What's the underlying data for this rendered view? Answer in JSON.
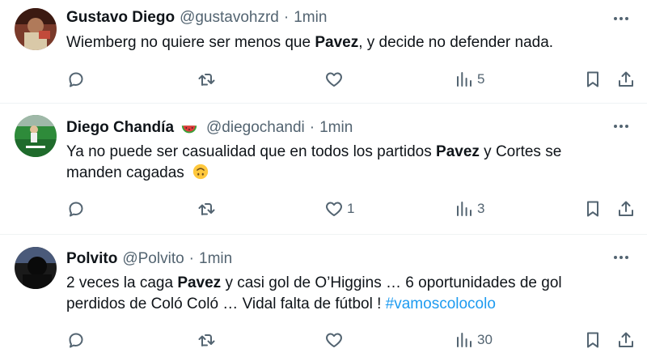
{
  "tweets": [
    {
      "name": "Gustavo Diego",
      "handle": "@gustavohzrd",
      "separator": "·",
      "time": "1min",
      "text_parts": [
        "Wiemberg no quiere ser menos que ",
        "Pavez",
        ", y decide no defender nada."
      ],
      "replies": "",
      "retweets": "",
      "likes": "",
      "views": "5"
    },
    {
      "name": "Diego Chandía",
      "name_emoji": "watermelon-emoji",
      "handle": "@diegochandi",
      "separator": "·",
      "time": "1min",
      "text_parts": [
        "Ya no puede ser casualidad que en todos los partidos ",
        "Pavez",
        " y Cortes se manden cagadas "
      ],
      "text_emoji": "upside-down-face-emoji",
      "replies": "",
      "retweets": "",
      "likes": "1",
      "views": "3"
    },
    {
      "name": "Polvito",
      "handle": "@Polvito",
      "separator": "·",
      "time": "1min",
      "text_parts": [
        "2 veces la caga ",
        "Pavez",
        " y casi gol de O’Higgins … 6 oportunidades de gol perdidos de Coló Coló … Vidal falta de fútbol ! ",
        "#vamoscolocolo"
      ],
      "replies": "",
      "retweets": "",
      "likes": "",
      "views": "30"
    }
  ],
  "icons": {
    "reply": "reply-icon",
    "retweet": "retweet-icon",
    "like": "heart-icon",
    "views": "views-icon",
    "bookmark": "bookmark-icon",
    "share": "share-icon",
    "more": "more-icon"
  },
  "colors": {
    "text": "#0f1419",
    "secondary": "#536471",
    "link": "#1d9bf0",
    "divider": "#eff3f4"
  }
}
